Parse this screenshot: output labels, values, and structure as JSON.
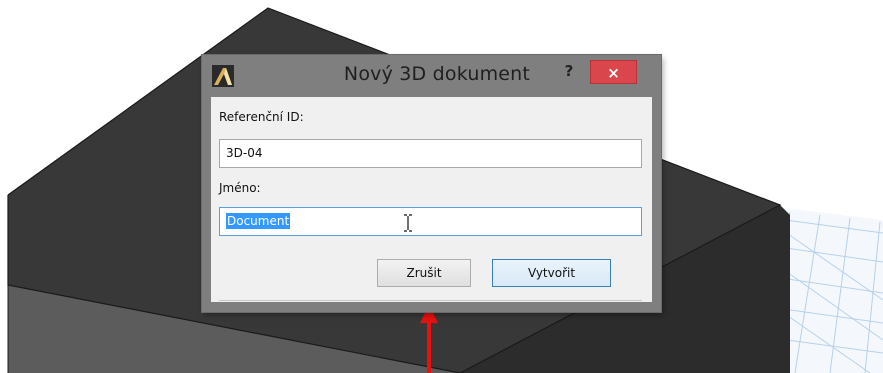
{
  "dialog": {
    "title": "Nový 3D dokument",
    "help_label": "?",
    "close_label": "×",
    "reference_id_label": "Referenční ID:",
    "reference_id_value": "3D-04",
    "name_label": "Jméno:",
    "name_value": "Document",
    "cancel_label": "Zrušit",
    "create_label": "Vytvořit"
  },
  "colors": {
    "close_button": "#d9464b",
    "selection": "#3399ff",
    "arrow": "#e81010",
    "box_top": "#383838",
    "grid": "#b7d0ea"
  }
}
